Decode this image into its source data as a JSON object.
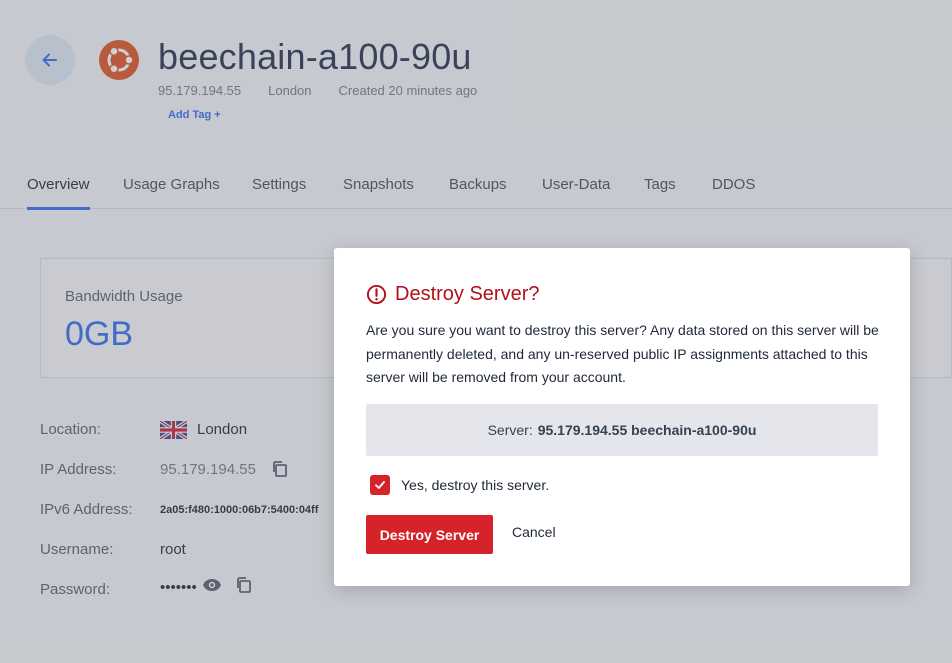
{
  "header": {
    "title": "beechain-a100-90u",
    "ip": "95.179.194.55",
    "location": "London",
    "created": "Created 20 minutes ago",
    "add_tag": "Add Tag +"
  },
  "tabs": [
    {
      "label": "Overview",
      "active": true
    },
    {
      "label": "Usage Graphs",
      "active": false
    },
    {
      "label": "Settings",
      "active": false
    },
    {
      "label": "Snapshots",
      "active": false
    },
    {
      "label": "Backups",
      "active": false
    },
    {
      "label": "User-Data",
      "active": false
    },
    {
      "label": "Tags",
      "active": false
    },
    {
      "label": "DDOS",
      "active": false
    }
  ],
  "bandwidth": {
    "label": "Bandwidth Usage",
    "value": "0GB"
  },
  "details": {
    "location_label": "Location:",
    "location_value": "London",
    "ip_label": "IP Address:",
    "ip_value": "95.179.194.55",
    "ipv6_label": "IPv6 Address:",
    "ipv6_value": "2a05:f480:1000:06b7:5400:04ff",
    "username_label": "Username:",
    "username_value": "root",
    "password_label": "Password:",
    "password_value": "•••••••"
  },
  "modal": {
    "title": "Destroy Server?",
    "body": "Are you sure you want to destroy this server? Any data stored on this server will be permanently deleted, and any un-reserved public IP assignments attached to this server will be removed from your account.",
    "server_prefix": "Server:",
    "server_value": "95.179.194.55 beechain-a100-90u",
    "confirm_label": "Yes, destroy this server.",
    "confirm_checked": true,
    "destroy_label": "Destroy Server",
    "cancel_label": "Cancel"
  },
  "colors": {
    "accent": "#2563eb",
    "danger": "#d6232a",
    "ubuntu": "#dd4814"
  },
  "icons": [
    "back-arrow-icon",
    "ubuntu-logo-icon",
    "uk-flag-icon",
    "copy-icon",
    "eye-icon",
    "alert-circle-icon",
    "checkmark-icon"
  ]
}
